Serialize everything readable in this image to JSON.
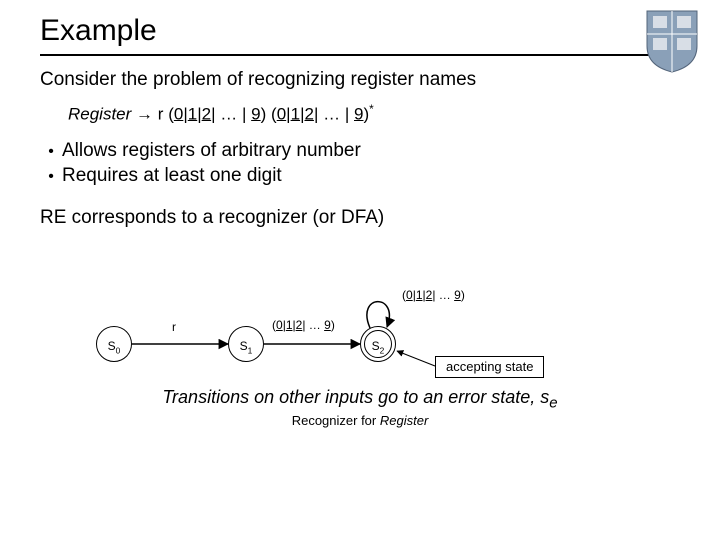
{
  "title": "Example",
  "intro": "Consider the problem of recognizing register names",
  "grammar": {
    "lhs": "Register",
    "arrow": "→",
    "r": "r",
    "open": "(",
    "close": ")",
    "alt0": "0",
    "alt1": "1",
    "alt2": "2",
    "ellipsis": "…",
    "alt9": "9",
    "bar": "|",
    "star": "*"
  },
  "bullets": {
    "items": [
      {
        "text": "Allows registers of arbitrary number"
      },
      {
        "text": "Requires at least one digit"
      }
    ]
  },
  "re_line": "RE corresponds to a recognizer (or DFA)",
  "dfa": {
    "states": {
      "s0": "S",
      "s0_sub": "0",
      "s1": "S",
      "s1_sub": "1",
      "s2": "S",
      "s2_sub": "2"
    },
    "trans": {
      "r": "r",
      "digits_open": "(",
      "digits_close": ")",
      "d0": "0",
      "d1": "1",
      "d2": "2",
      "dots": "…",
      "d9": "9",
      "bar": "|"
    },
    "accept_label": "accepting state"
  },
  "footer_note": "Transitions on other inputs go to an error state, s",
  "footer_note_sub": "e",
  "footer_caption": "Recognizer for Register"
}
